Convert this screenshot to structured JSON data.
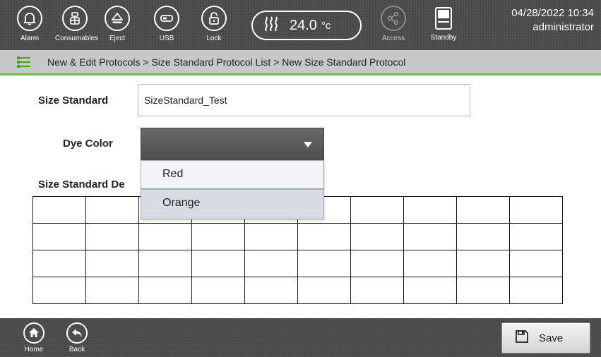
{
  "topbar": {
    "alarm_label": "Alarm",
    "consumables_label": "Consumables",
    "eject_label": "Eject",
    "usb_label": "USB",
    "lock_label": "Lock",
    "temperature_value": "24.0",
    "temperature_unit": "°c",
    "access_label": "Access",
    "standby_label": "Standby",
    "datetime": "04/28/2022 10:34",
    "user": "administrator",
    "icons": {
      "alarm": "bell-icon",
      "consumables": "consumables-icon",
      "eject": "eject-icon",
      "usb": "usb-icon",
      "lock": "lock-icon",
      "heater": "heat-waves-icon",
      "access": "share-icon",
      "standby": "standby-icon"
    }
  },
  "breadcrumb": {
    "text": "New & Edit Protocols > Size Standard Protocol List > New Size Standard Protocol"
  },
  "form": {
    "size_standard_label": "Size Standard",
    "size_standard_value": "SizeStandard_Test",
    "dye_color_label": "Dye Color",
    "dye_color_value": "",
    "dye_color_options": [
      "Red",
      "Orange"
    ],
    "definition_label": "Size Standard De"
  },
  "definition_table": {
    "columns": 10,
    "rows": [
      [
        "",
        "",
        "",
        "",
        "",
        "",
        "",
        "",
        "",
        ""
      ],
      [
        "",
        "",
        "",
        "",
        "",
        "",
        "",
        "",
        "",
        ""
      ],
      [
        "",
        "",
        "",
        "",
        "",
        "",
        "",
        "",
        "",
        ""
      ],
      [
        "",
        "",
        "",
        "",
        "",
        "",
        "",
        "",
        "",
        ""
      ]
    ]
  },
  "bottombar": {
    "home_label": "Home",
    "back_label": "Back",
    "save_label": "Save"
  },
  "colors": {
    "bar_dark": "#4a4a4a",
    "breadcrumb_bg": "#c8c8c8",
    "accent_green": "#6fbf44",
    "dropdown_selected": "#d7dbe2"
  }
}
